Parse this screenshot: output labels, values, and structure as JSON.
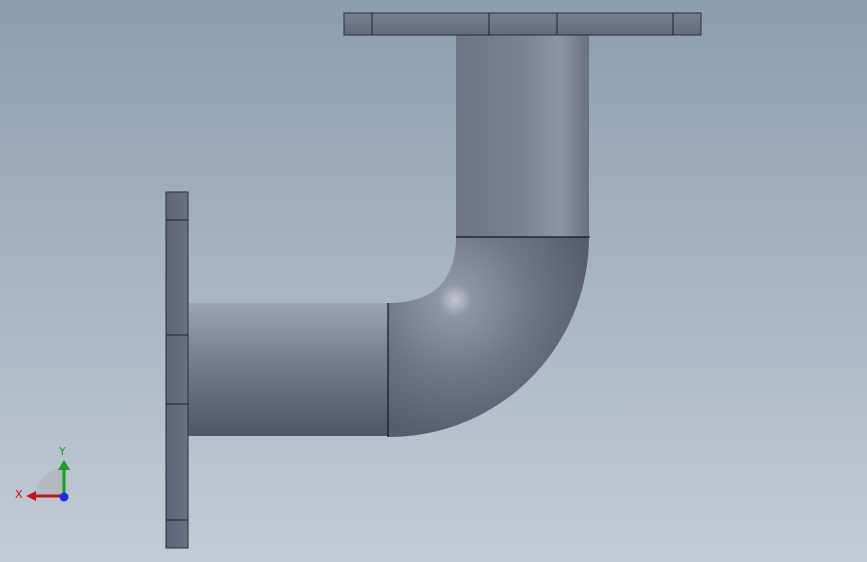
{
  "viewport": {
    "background_top": "#8c9db0",
    "background_bottom": "#c4cbd5"
  },
  "model": {
    "parts": [
      "pipe-elbow",
      "horizontal-pipe-segment",
      "vertical-pipe-segment",
      "left-flange",
      "top-flange"
    ],
    "pipe_color": "#6b7080",
    "flange_color": "#62677a"
  },
  "triad": {
    "x_label": "X",
    "y_label": "Y",
    "x_color": "#c0161b",
    "y_color": "#14a21e",
    "z_color": "#1a2fd8"
  }
}
